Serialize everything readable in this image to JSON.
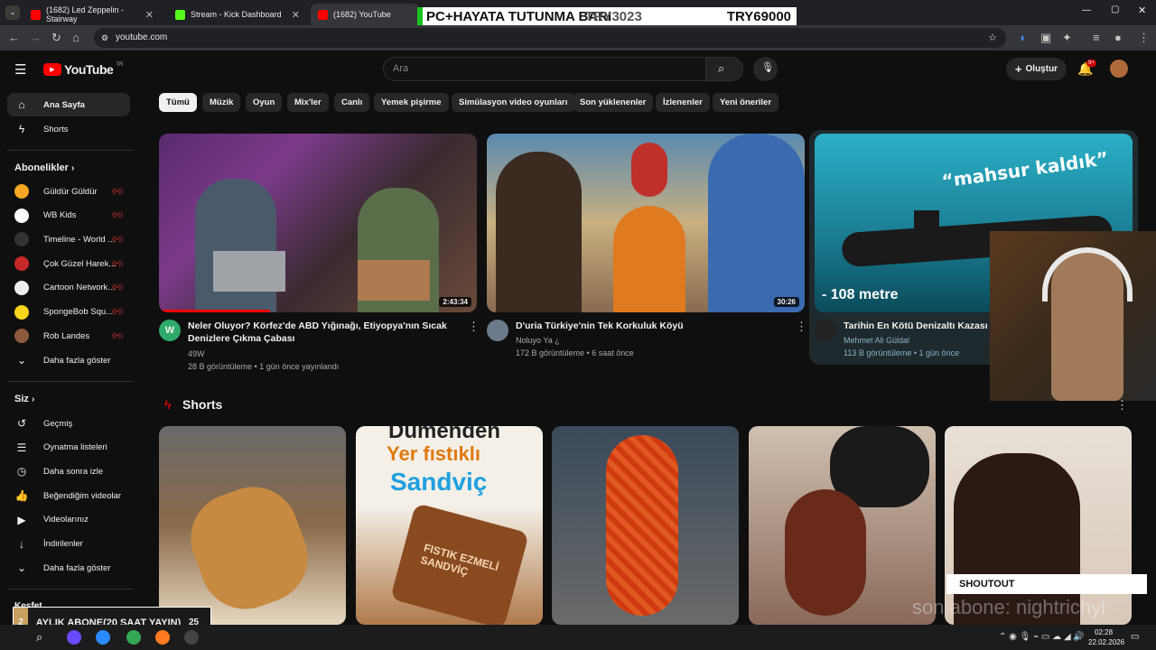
{
  "tabs": [
    {
      "title": "(1682) Led Zeppelin - Stairway",
      "color": "#ff0000"
    },
    {
      "title": "Stream - Kick Dashboard",
      "color": "#53fc18"
    },
    {
      "title": "(1682) YouTube",
      "color": "#ff0000"
    }
  ],
  "overlay": {
    "donation_text": "PC+HAYATA TUTUNMA BARI",
    "donation_left": "TRY3023",
    "donation_right": "TRY69000",
    "sub_label": "AYLIK ABONE(20 SAAT YAYIN)",
    "sub_left": "2",
    "sub_right": "25",
    "shoutout": "SHOUTOUT",
    "last_sub": "son abone: nightrichyl"
  },
  "address": {
    "url": "youtube.com"
  },
  "header": {
    "logo": "YouTube",
    "logo_sup": "TR",
    "search_placeholder": "Ara",
    "create_label": "Oluştur",
    "notif_badge": "9+"
  },
  "sidebar": {
    "home": "Ana Sayfa",
    "shorts": "Shorts",
    "subs_title": "Abonelikler",
    "subs": [
      {
        "name": "Güldür Güldür",
        "color": "#f5a623"
      },
      {
        "name": "WB Kids",
        "color": "#ffffff"
      },
      {
        "name": "Timeline - World ...",
        "color": "#333333"
      },
      {
        "name": "Çok Güzel Harek...",
        "color": "#c62828"
      },
      {
        "name": "Cartoon Network...",
        "color": "#eeeeee"
      },
      {
        "name": "SpongeBob Squ...",
        "color": "#f7d51d"
      },
      {
        "name": "Rob Landes",
        "color": "#8d5a3c"
      }
    ],
    "more1": "Daha fazla göster",
    "you_title": "Siz",
    "you": [
      {
        "name": "Geçmiş",
        "icon": "history-icon",
        "glyph": "↺"
      },
      {
        "name": "Oynatma listeleri",
        "icon": "playlist-icon",
        "glyph": "☰"
      },
      {
        "name": "Daha sonra izle",
        "icon": "clock-icon",
        "glyph": "◷"
      },
      {
        "name": "Beğendiğim videolar",
        "icon": "like-icon",
        "glyph": "👍"
      },
      {
        "name": "Videolarınız",
        "icon": "video-icon",
        "glyph": "▶"
      },
      {
        "name": "İndirilenler",
        "icon": "download-icon",
        "glyph": "↓"
      }
    ],
    "more2": "Daha fazla göster",
    "explore": "Keşfet"
  },
  "chips": [
    "Tümü",
    "Müzik",
    "Oyun",
    "Mix'ler",
    "Canlı",
    "Yemek pişirme",
    "Simülasyon video oyunları",
    "Son yüklenenler",
    "İzlenenler",
    "Yeni öneriler"
  ],
  "videos": [
    {
      "title": "Neler Oluyor? Körfez'de ABD Yığınağı, Etiyopya'nın Sıcak Denizlere Çıkma Çabası",
      "channel": "49W",
      "meta": "28 B görüntüleme • 1 gün önce yayınlandı",
      "duration": "2:43:34"
    },
    {
      "title": "D'uria Türkiye'nin Tek  Korkuluk Köyü",
      "channel": "Noluyo Ya ¿",
      "meta": "172 B görüntüleme • 6 saat önce",
      "duration": "30:26"
    },
    {
      "title": "Tarihin En Kötü Denizaltı Kazası - K",
      "channel": "Mehmet Ali Güldal",
      "meta": "113 B görüntüleme • 1 gün önce",
      "thumb_text": "“mahsur kaldık”",
      "thumb_sub": "- 108 metre"
    }
  ],
  "shorts_title": "Shorts",
  "shorts_texts": {
    "s2_top": "Dümenden",
    "s2_line1": "Yer fıstıklı",
    "s2_line2": "Sandviç",
    "s2_pack": "FISTIK EZMELİ SANDVİÇ"
  },
  "taskbar": {
    "time": "02:28",
    "date": "22.02.2026"
  }
}
